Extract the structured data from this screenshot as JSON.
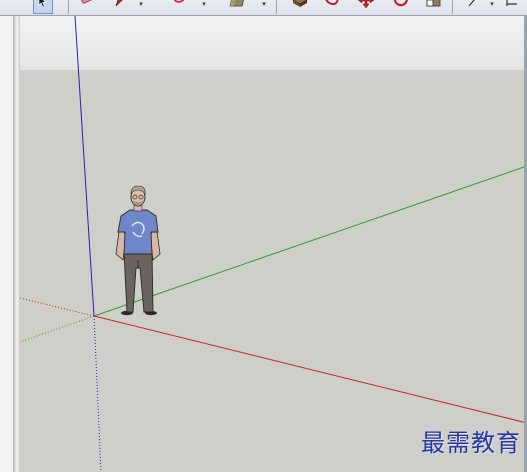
{
  "toolbar": {
    "tools": [
      {
        "name": "select",
        "icon": "select-arrow-icon",
        "active": true
      },
      {
        "name": "eraser",
        "icon": "eraser-icon"
      },
      {
        "name": "pencil",
        "icon": "pencil-icon"
      },
      {
        "name": "arc",
        "icon": "arc-icon"
      },
      {
        "name": "shape",
        "icon": "rectangle-icon"
      },
      {
        "name": "push-pull",
        "icon": "push-pull-icon"
      },
      {
        "name": "follow-me",
        "icon": "follow-me-icon"
      },
      {
        "name": "move",
        "icon": "move-icon"
      },
      {
        "name": "rotate",
        "icon": "rotate-icon"
      },
      {
        "name": "scale",
        "icon": "scale-icon"
      },
      {
        "name": "tape-measure",
        "icon": "tape-measure-icon"
      }
    ]
  },
  "viewport": {
    "sky_color": "#ecedee",
    "ground_color": "#cfcfc9",
    "axes": {
      "red": "#c0262d",
      "green": "#2e9a2e",
      "blue": "#2323b8"
    }
  },
  "watermark": {
    "text": "最需教育"
  }
}
